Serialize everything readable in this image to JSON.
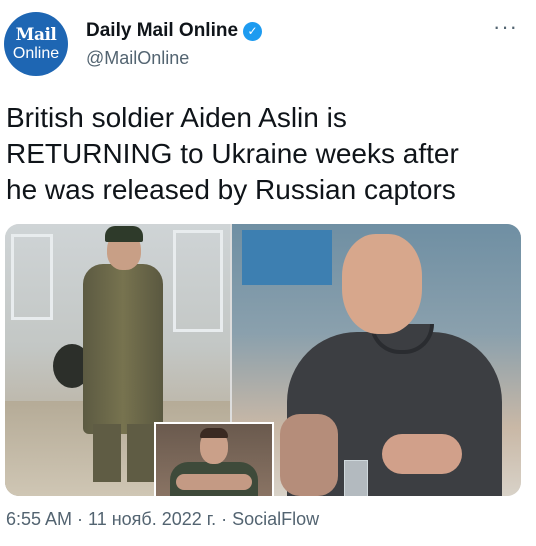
{
  "account": {
    "avatar_line1": "Mail",
    "avatar_line2": "Online",
    "name": "Daily Mail Online",
    "handle": "@MailOnline",
    "verified_icon": "verified-badge-icon"
  },
  "menu": {
    "more_label": "···"
  },
  "tweet": {
    "line1": "British soldier Aiden Aslin is",
    "line2": "RETURNING to Ukraine weeks after",
    "line3": "he was released by Russian captors"
  },
  "media": {
    "left_photo": "soldier-in-barracks-photo",
    "right_photo": "man-in-polo-interview-photo",
    "inset_photo": "inset-portrait-photo"
  },
  "footer": {
    "time": "6:55 AM",
    "sep1": " · ",
    "date": "11 нояб. 2022 г.",
    "sep2": " · ",
    "source": "SocialFlow"
  },
  "colors": {
    "avatar_bg": "#1e66b3",
    "verified": "#1d9bf0",
    "secondary_text": "#536471",
    "primary_text": "#0f1419"
  }
}
